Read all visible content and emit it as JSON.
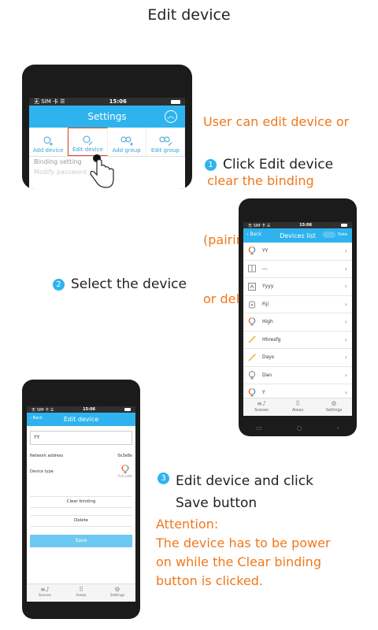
{
  "title": "Edit device",
  "colors": {
    "accent": "#2fb3ee",
    "note": "#f0781c",
    "highlight": "#e0482c"
  },
  "phone1": {
    "status": {
      "left": "无 SIM 卡 ☰",
      "time": "15:06"
    },
    "header": "Settings",
    "menu": [
      {
        "label": "Add device",
        "icon": "bulb-plus-icon"
      },
      {
        "label": "Edit device",
        "icon": "bulb-edit-icon"
      },
      {
        "label": "Add group",
        "icon": "group-plus-icon"
      },
      {
        "label": "Edit group",
        "icon": "group-edit-icon"
      }
    ],
    "row1": "Binding setting",
    "row2": "Modify password"
  },
  "annotations": {
    "intro": [
      "User can edit device or",
      " clear the binding",
      "(pairing) list in device",
      "or delete device"
    ],
    "step1": {
      "number": "1",
      "text": "Click Edit device"
    },
    "step2": {
      "number": "2",
      "text": "Select the device"
    },
    "step3": {
      "number": "3",
      "line1": "Edit device and click",
      "line2": "Save button"
    },
    "attention": [
      "Attention:",
      "The device has to be power",
      "on while the Clear binding",
      "button is clicked."
    ]
  },
  "phone2": {
    "status": {
      "left": "无 SIM 卡 ☰",
      "time": "15:06"
    },
    "header": "Devices list",
    "back": "Back",
    "btn_a": "Add",
    "btn_b": "Date",
    "devices": [
      {
        "name": "YY",
        "icon": "color-bulb-icon"
      },
      {
        "name": "---",
        "icon": "panel-icon"
      },
      {
        "name": "Yyyy",
        "icon": "switch-icon"
      },
      {
        "name": "Fiji",
        "icon": "plug-icon"
      },
      {
        "name": "High",
        "icon": "color-bulb-icon"
      },
      {
        "name": "Hhresfg",
        "icon": "wand-icon"
      },
      {
        "name": "Days",
        "icon": "wand-icon"
      },
      {
        "name": "Dan",
        "icon": "bulb-icon"
      },
      {
        "name": "Y",
        "icon": "color-bulb-icon"
      }
    ],
    "nav": [
      "Scenes",
      "Areas",
      "Settings"
    ]
  },
  "phone3": {
    "status": {
      "left": "无 SIM 卡 ☰",
      "time": "15:06"
    },
    "header": "Edit device",
    "back": "Back",
    "name_value": "YY",
    "network_label": "Network address",
    "network_value": "0x3e8e",
    "type_label": "Device type",
    "type_value": "Full color",
    "clear_binding": "Clear binding",
    "delete": "Delete",
    "save": "Save",
    "nav": [
      "Scenes",
      "Areas",
      "Settings"
    ]
  }
}
